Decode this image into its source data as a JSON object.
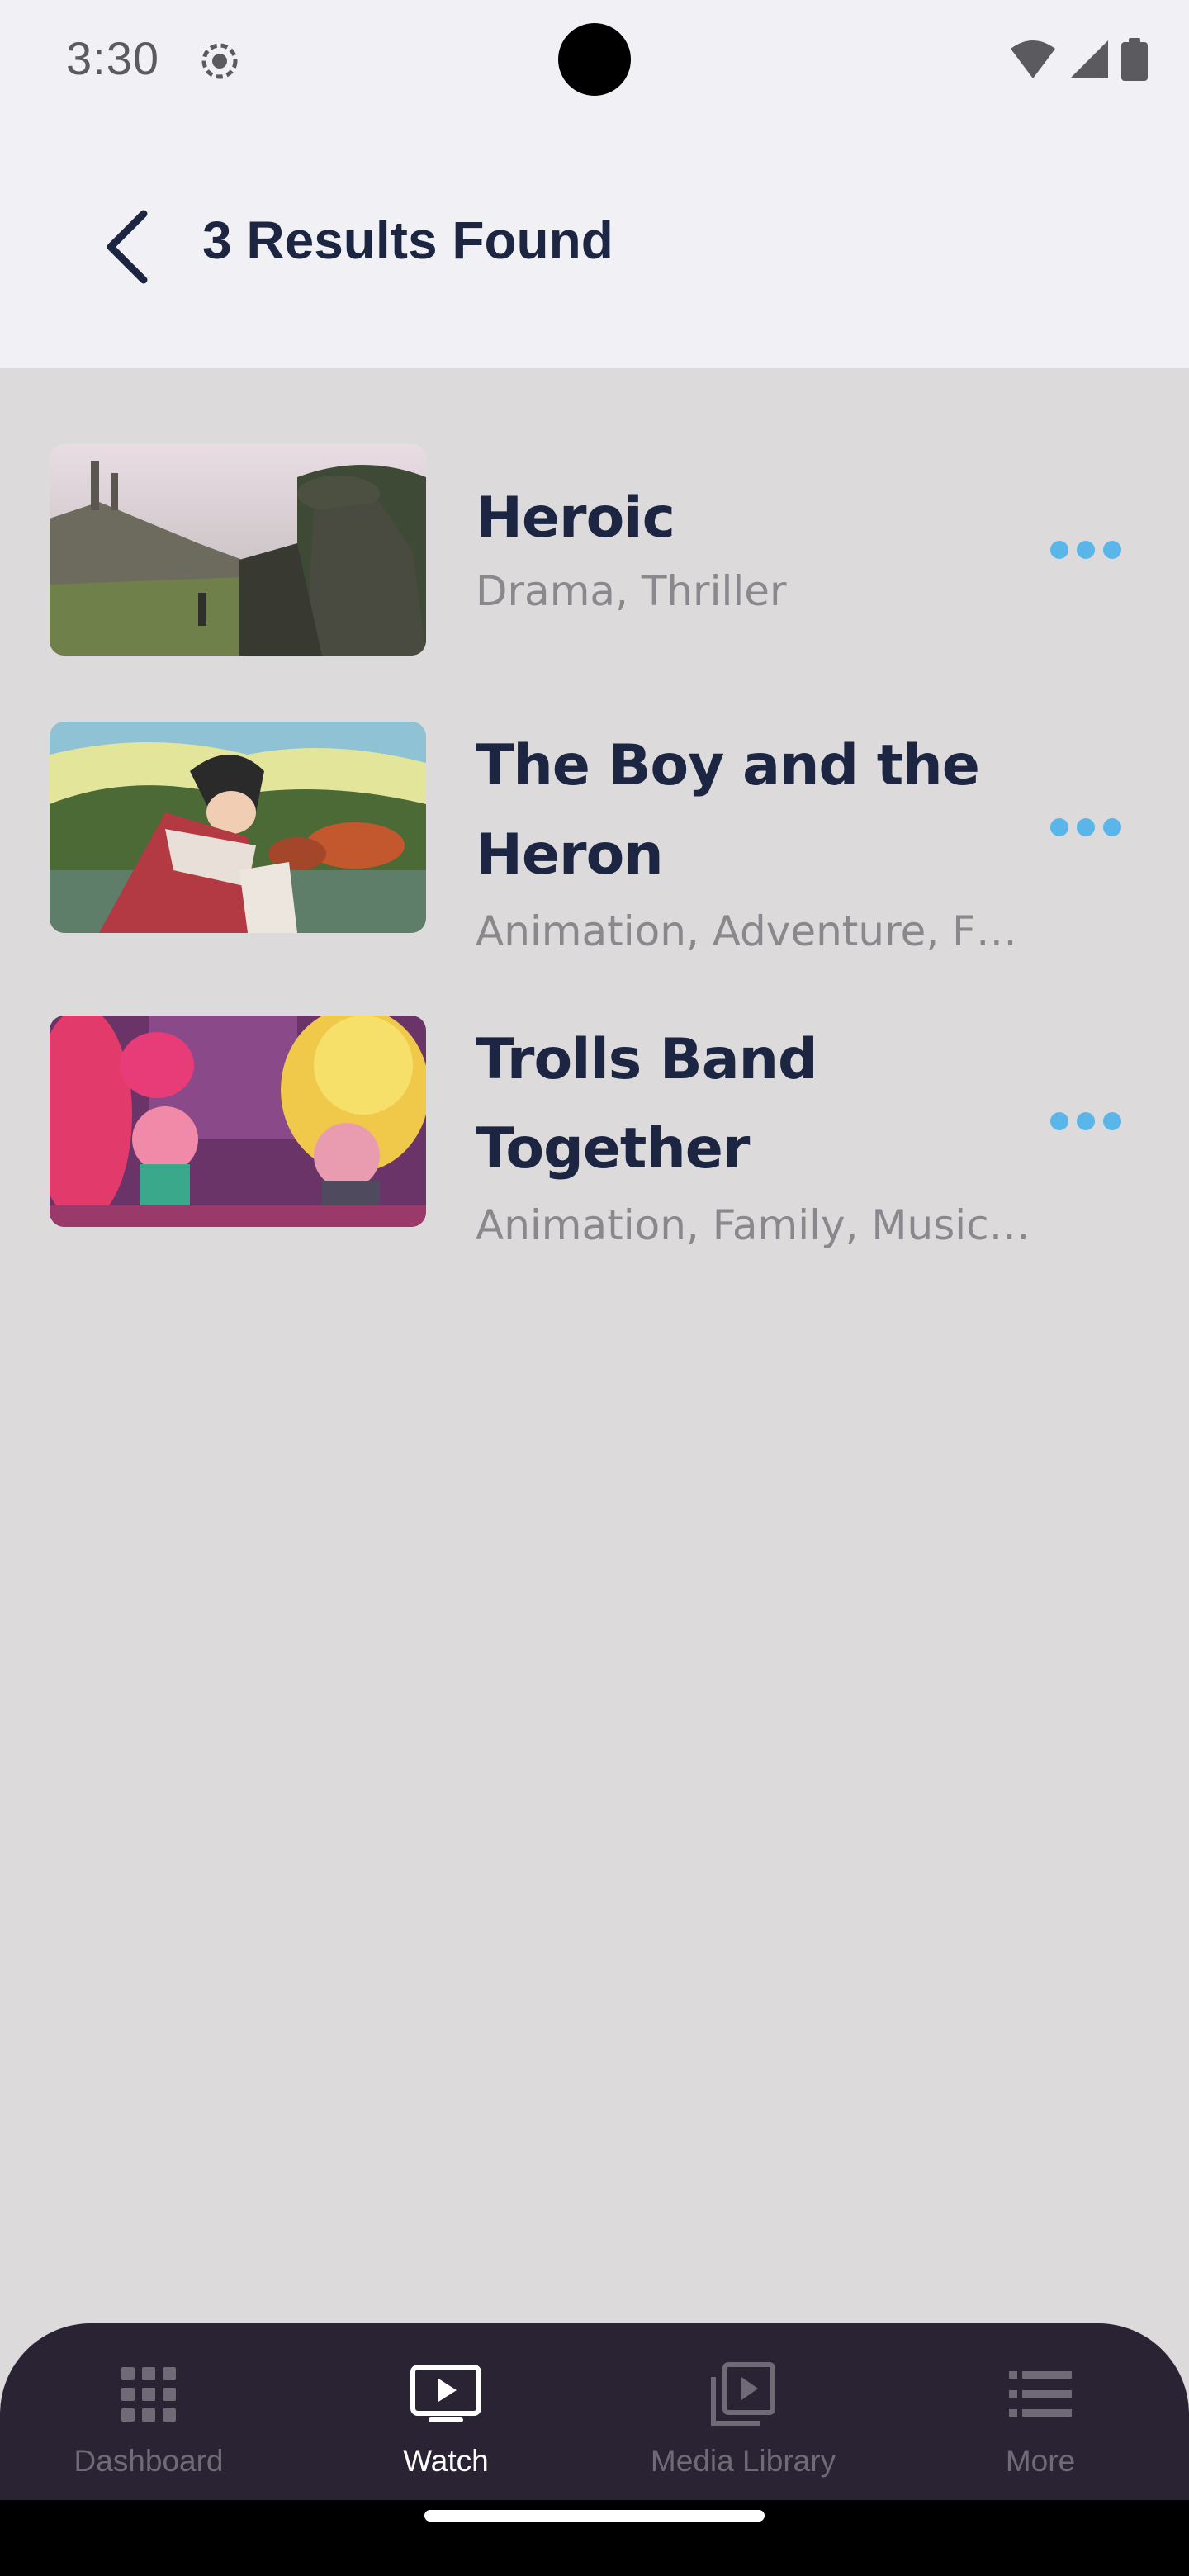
{
  "status_bar": {
    "time": "3:30"
  },
  "header": {
    "title": "3 Results Found"
  },
  "results": [
    {
      "title_lines": [
        "Heroic"
      ],
      "genres": "Drama, Thriller"
    },
    {
      "title_lines": [
        "The Boy and the",
        "Heron"
      ],
      "genres": "Animation, Adventure, F…"
    },
    {
      "title_lines": [
        "Trolls Band",
        "Together"
      ],
      "genres": "Animation, Family, Music…"
    }
  ],
  "bottom_nav": {
    "items": [
      {
        "label": "Dashboard",
        "icon": "grid-icon",
        "active": false
      },
      {
        "label": "Watch",
        "icon": "play-screen-icon",
        "active": true
      },
      {
        "label": "Media Library",
        "icon": "media-library-icon",
        "active": false
      },
      {
        "label": "More",
        "icon": "list-icon",
        "active": false
      }
    ]
  },
  "colors": {
    "accent": "#5ab5e8",
    "title": "#1c2541",
    "nav_background": "#2a2333",
    "page_background": "#dcdadb"
  }
}
